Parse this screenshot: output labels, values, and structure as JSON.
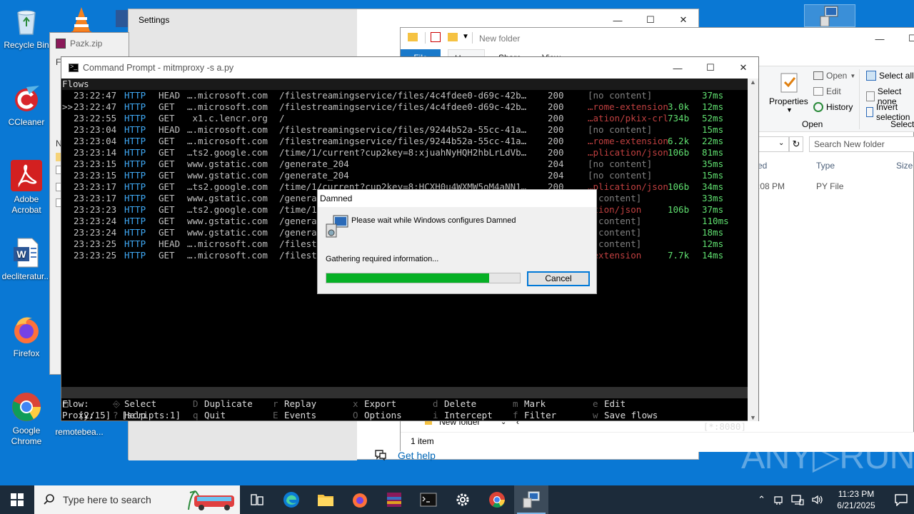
{
  "desktop": {
    "icons": [
      {
        "label": "Recycle Bin"
      },
      {
        "label": "CCleaner"
      },
      {
        "label": "Adobe Acrobat"
      },
      {
        "label": "decliteratur..."
      },
      {
        "label": "Firefox"
      },
      {
        "label": "Google Chrome"
      },
      {
        "label": "remotebea..."
      }
    ]
  },
  "settings_window": {
    "title": "Settings",
    "get_help": "Get help"
  },
  "zip_window": {
    "title": "Pazk.zip"
  },
  "explorer": {
    "title": "New folder",
    "tabs": [
      "File",
      "Home",
      "Share",
      "View"
    ],
    "ribbon": {
      "properties": "Properties",
      "open": "Open",
      "edit": "Edit",
      "history": "History",
      "open_group": "Open",
      "select_all": "Select all",
      "select_none": "Select none",
      "invert_selection": "Invert selection",
      "select_group": "Select"
    },
    "search_placeholder": "Search New folder",
    "columns": {
      "modified": "ed",
      "type": "Type",
      "size": "Size"
    },
    "row": {
      "modified": ":08 PM",
      "type": "PY File"
    },
    "nav_item": "New folder",
    "status": "1 item"
  },
  "cmd": {
    "title": "Command Prompt - mitmproxy  -s a.py",
    "header": "Flows",
    "flows": [
      {
        "mark": "  ",
        "time": "23:22:47",
        "proto": "HTTP",
        "method": "HEAD",
        "host": "….microsoft.com",
        "path": "/filestreamingservice/files/4c4fdee0-d69c-42b…",
        "code": "200",
        "type": "[no content]",
        "size": "",
        "dur": "37ms",
        "type_muted": true
      },
      {
        "mark": ">>",
        "time": "23:22:47",
        "proto": "HTTP",
        "method": "GET",
        "host": "….microsoft.com",
        "path": "/filestreamingservice/files/4c4fdee0-d69c-42b…",
        "code": "200",
        "type": "…rome-extension",
        "size": "3.0k",
        "dur": "12ms",
        "type_muted": false
      },
      {
        "mark": "  ",
        "time": "23:22:55",
        "proto": "HTTP",
        "method": "GET",
        "host": " x1.c.lencr.org",
        "path": "/",
        "code": "200",
        "type": "…ation/pkix-crl",
        "size": "734b",
        "dur": "52ms",
        "type_muted": false
      },
      {
        "mark": "  ",
        "time": "23:23:04",
        "proto": "HTTP",
        "method": "HEAD",
        "host": "….microsoft.com",
        "path": "/filestreamingservice/files/9244b52a-55cc-41a…",
        "code": "200",
        "type": "[no content]",
        "size": "",
        "dur": "15ms",
        "type_muted": true
      },
      {
        "mark": "  ",
        "time": "23:23:04",
        "proto": "HTTP",
        "method": "GET",
        "host": "….microsoft.com",
        "path": "/filestreamingservice/files/9244b52a-55cc-41a…",
        "code": "200",
        "type": "…rome-extension",
        "size": "6.2k",
        "dur": "22ms",
        "type_muted": false
      },
      {
        "mark": "  ",
        "time": "23:23:14",
        "proto": "HTTP",
        "method": "GET",
        "host": "…ts2.google.com",
        "path": "/time/1/current?cup2key=8:xjuahNyHQH2hbLrLdVb…",
        "code": "200",
        "type": "…plication/json",
        "size": "106b",
        "dur": "81ms",
        "type_muted": false
      },
      {
        "mark": "  ",
        "time": "23:23:15",
        "proto": "HTTP",
        "method": "GET",
        "host": "www.gstatic.com",
        "path": "/generate_204",
        "code": "204",
        "type": "[no content]",
        "size": "",
        "dur": "35ms",
        "type_muted": true
      },
      {
        "mark": "  ",
        "time": "23:23:15",
        "proto": "HTTP",
        "method": "GET",
        "host": "www.gstatic.com",
        "path": "/generate_204",
        "code": "204",
        "type": "[no content]",
        "size": "",
        "dur": "15ms",
        "type_muted": true
      },
      {
        "mark": "  ",
        "time": "23:23:17",
        "proto": "HTTP",
        "method": "GET",
        "host": "…ts2.google.com",
        "path": "/time/1/current?cup2key=8:HCXH0u4WXMW5oM4aNN1…",
        "code": "200",
        "type": "…plication/json",
        "size": "106b",
        "dur": "34ms",
        "type_muted": false
      },
      {
        "mark": "  ",
        "time": "23:23:17",
        "proto": "HTTP",
        "method": "GET",
        "host": "www.gstatic.com",
        "path": "/genera",
        "code": "",
        "type": "o content]",
        "size": "",
        "dur": "33ms",
        "type_muted": true
      },
      {
        "mark": "  ",
        "time": "23:23:23",
        "proto": "HTTP",
        "method": "GET",
        "host": "…ts2.google.com",
        "path": "/time/1",
        "code": "",
        "type": "ation/json",
        "size": "106b",
        "dur": "37ms",
        "type_muted": false
      },
      {
        "mark": "  ",
        "time": "23:23:24",
        "proto": "HTTP",
        "method": "GET",
        "host": "www.gstatic.com",
        "path": "/genera",
        "code": "",
        "type": "o content]",
        "size": "",
        "dur": "110ms",
        "type_muted": true
      },
      {
        "mark": "  ",
        "time": "23:23:24",
        "proto": "HTTP",
        "method": "GET",
        "host": "www.gstatic.com",
        "path": "/genera",
        "code": "",
        "type": "o content]",
        "size": "",
        "dur": "18ms",
        "type_muted": true
      },
      {
        "mark": "  ",
        "time": "23:23:25",
        "proto": "HTTP",
        "method": "HEAD",
        "host": "….microsoft.com",
        "path": "/filest",
        "code": "",
        "type": "o content]",
        "size": "",
        "dur": "12ms",
        "type_muted": true
      },
      {
        "mark": "  ",
        "time": "23:23:25",
        "proto": "HTTP",
        "method": "GET",
        "host": "….microsoft.com",
        "path": "/filest",
        "code": "",
        "type": "-extension",
        "size": "7.7k",
        "dur": "14ms",
        "type_muted": false
      }
    ],
    "status_left": "[2/15]  [scripts:1]",
    "status_right": "[*:8080]",
    "keys_row1_label": "Flow:",
    "keys_row2_label": "Proxy:",
    "keys_row1": [
      {
        "key": "⎆",
        "action": "Select"
      },
      {
        "key": "D",
        "action": "Duplicate"
      },
      {
        "key": "r",
        "action": "Replay"
      },
      {
        "key": "x",
        "action": "Export"
      },
      {
        "key": "d",
        "action": "Delete"
      },
      {
        "key": "m",
        "action": "Mark"
      },
      {
        "key": "e",
        "action": "Edit"
      }
    ],
    "keys_row2": [
      {
        "key": "?",
        "action": "Help"
      },
      {
        "key": "q",
        "action": "Quit"
      },
      {
        "key": "E",
        "action": "Events"
      },
      {
        "key": "O",
        "action": "Options"
      },
      {
        "key": "i",
        "action": "Intercept"
      },
      {
        "key": "f",
        "action": "Filter"
      },
      {
        "key": "w",
        "action": "Save flows"
      }
    ]
  },
  "dialog": {
    "title": "Damned",
    "message": "Please wait while Windows configures Damned",
    "status": "Gathering required information...",
    "progress": 0.84,
    "cancel": "Cancel"
  },
  "taskbar": {
    "search_placeholder": "Type here to search",
    "time": "11:23 PM",
    "date": "6/21/2025"
  },
  "watermark": "ANY▷RUN",
  "colors": {
    "desktop": "#0a78d4",
    "progress": "#06b025",
    "taskbar": "#1c2b3a"
  }
}
